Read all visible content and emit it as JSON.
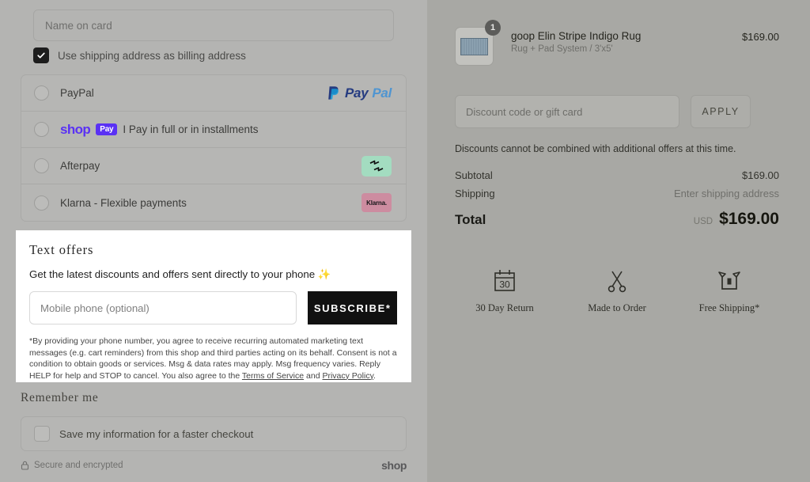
{
  "checkout": {
    "name_on_card_placeholder": "Name on card",
    "billing_checkbox_label": "Use shipping address as billing address",
    "payment_methods": [
      {
        "label": "PayPal",
        "badge": "paypal-logo"
      },
      {
        "label": "I Pay in full or in installments",
        "badge": "shop-pay-logo"
      },
      {
        "label": "Afterpay",
        "badge": "afterpay-badge"
      },
      {
        "label": "Klarna - Flexible payments",
        "badge": "klarna-badge"
      }
    ],
    "paypal": {
      "part1": "Pay",
      "part2": "Pal"
    },
    "shop_pay": {
      "word": "shop",
      "chip": "Pay"
    },
    "klarna": {
      "text": "Klarna."
    },
    "remember": {
      "title": "Remember me",
      "checkbox_label": "Save my information for a faster checkout"
    },
    "footer": {
      "secure_text": "Secure and encrypted",
      "shop_logo": "shop"
    }
  },
  "text_offers": {
    "title": "Text offers",
    "subtitle": "Get the latest discounts and offers sent directly to your phone",
    "sparkle": "✨",
    "phone_placeholder": "Mobile phone (optional)",
    "subscribe_label": "SUBSCRIBE*",
    "legal_part1": "*By providing your phone number, you agree to receive recurring automated marketing text messages (e.g. cart reminders) from this shop and third parties acting on its behalf. Consent is not a condition to obtain goods or services. Msg & data rates may apply. Msg frequency varies. Reply HELP for help and STOP to cancel. You also agree to the ",
    "terms_link": "Terms of Service",
    "legal_and": " and ",
    "privacy_link": "Privacy Policy",
    "legal_end": "."
  },
  "summary": {
    "product": {
      "title": "goop Elin Stripe Indigo Rug",
      "variant": "Rug + Pad System / 3'x5'",
      "price": "$169.00",
      "quantity": "1"
    },
    "discount_placeholder": "Discount code or gift card",
    "apply_label": "APPLY",
    "discount_note": "Discounts cannot be combined with additional offers at this time.",
    "subtotal_label": "Subtotal",
    "subtotal_value": "$169.00",
    "shipping_label": "Shipping",
    "shipping_value": "Enter shipping address",
    "total_label": "Total",
    "total_currency": "USD",
    "total_value": "$169.00",
    "badges": [
      {
        "label": "30 Day Return",
        "icon": "calendar-30-icon",
        "day": "30"
      },
      {
        "label": "Made to Order",
        "icon": "scissors-icon"
      },
      {
        "label": "Free Shipping*",
        "icon": "open-box-icon"
      }
    ]
  }
}
